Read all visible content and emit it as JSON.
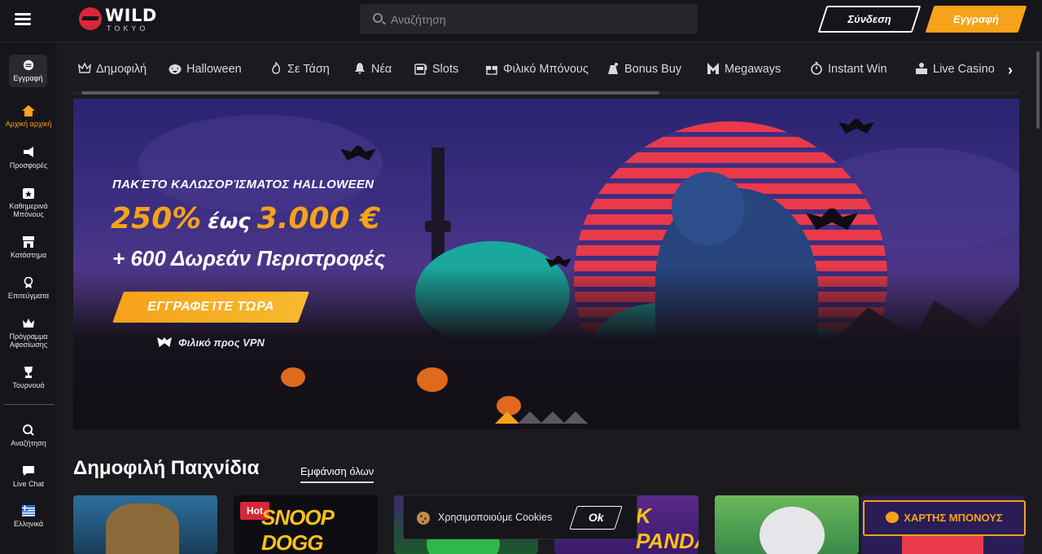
{
  "header": {
    "logo_main": "WILD",
    "logo_sub": "TOKYO",
    "search_placeholder": "Αναζήτηση",
    "login_label": "Σύνδεση",
    "register_label": "Εγγραφή"
  },
  "sidebar": {
    "items": [
      {
        "label": "Εγγραφή",
        "icon": "register-icon"
      },
      {
        "label": "Αρχική αρχική",
        "icon": "home-icon"
      },
      {
        "label": "Προσφορές",
        "icon": "megaphone-icon"
      },
      {
        "label": "Καθημερινά Μπόνους",
        "icon": "calendar-star-icon"
      },
      {
        "label": "Κατάστημα",
        "icon": "store-icon"
      },
      {
        "label": "Επιτεύγματα",
        "icon": "medal-icon"
      },
      {
        "label": "Πρόγραμμα Αφοσίωσης",
        "icon": "crown-icon"
      },
      {
        "label": "Τουρνουά",
        "icon": "trophy-icon"
      },
      {
        "label": "Αναζήτηση",
        "icon": "search-icon"
      },
      {
        "label": "Live Chat",
        "icon": "chat-icon"
      },
      {
        "label": "Ελληνικά",
        "icon": "greek-flag-icon"
      }
    ]
  },
  "categories": [
    {
      "label": "Δημοφιλή",
      "icon": "crown-icon"
    },
    {
      "label": "Halloween",
      "icon": "pumpkin-icon"
    },
    {
      "label": "Σε Τάση",
      "icon": "flame-icon"
    },
    {
      "label": "Νέα",
      "icon": "bell-icon"
    },
    {
      "label": "Slots",
      "icon": "slot-machine-icon"
    },
    {
      "label": "Φιλικό Μπόνους",
      "icon": "gift-icon"
    },
    {
      "label": "Bonus Buy",
      "icon": "bag-icon"
    },
    {
      "label": "Megaways",
      "icon": "m-icon"
    },
    {
      "label": "Instant Win",
      "icon": "stopwatch-icon"
    },
    {
      "label": "Live Casino",
      "icon": "dealer-icon"
    }
  ],
  "banner": {
    "kicker": "ΠΑΚΈΤΟ ΚΑΛΩΣΟΡΊΣΜΑΤΟΣ HALLOWEEN",
    "percent": "250%",
    "up_to": "έως",
    "amount": "3.000 €",
    "spins": "+ 600 Δωρεάν Περιστροφές",
    "cta": "ΕΓΓΡΑΦΕΊΤΕ ΤΏΡΑ",
    "vpn": "Φιλικό προς VPN",
    "slide_count": 4,
    "active_slide": 1
  },
  "popular": {
    "title": "Δημοφιλή Παιχνίδια",
    "show_all": "Εμφάνιση όλων",
    "hot_badge": "Hot",
    "card2_title": "SNOOP DOGG DOLLARS",
    "card4_title": "K PANDA",
    "bonus_map": "ΧΑΡΤΗΣ ΜΠΟΝΟΥΣ"
  },
  "cookie": {
    "text": "Χρησιμοποιούμε Cookies",
    "ok": "Ok"
  },
  "colors": {
    "accent": "#f6a21a",
    "background": "#1b1a1f",
    "hot": "#d8263a"
  }
}
